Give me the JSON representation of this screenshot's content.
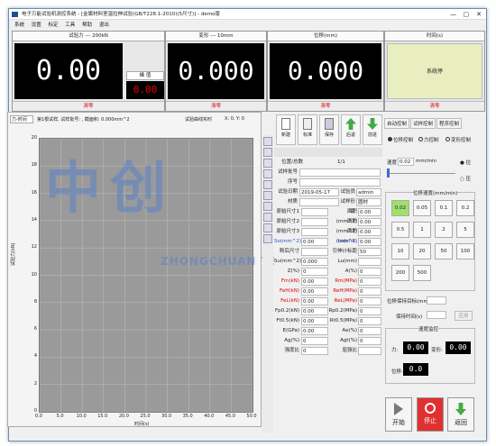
{
  "window": {
    "title": "电子万能试验机测控系统 - [金属材料室温拉伸试验(GB/T228.1-2010)(5尺寸)] - demo版",
    "controls": [
      "—",
      "▢",
      "✕"
    ]
  },
  "menu": [
    "系统",
    "设置",
    "标定",
    "工具",
    "帮助",
    "退出"
  ],
  "meters": {
    "force": {
      "caption": "试验力 --- 200kN",
      "value": "0.00",
      "peak_caption": "峰 值",
      "peak_value": "0.00",
      "zero": "清零"
    },
    "deform": {
      "caption": "变形 --- 10mm",
      "value": "0.000",
      "zero": "清零"
    },
    "disp": {
      "caption": "位移(mm)",
      "value": "0.000",
      "zero": "清零"
    },
    "time": {
      "caption": "时间(s)",
      "status": "系统停",
      "zero": "清零"
    }
  },
  "chart_header": {
    "mode": "力-时间",
    "info": "第1根试样, 试样批号: , 截面积: 0.000mm^2",
    "coord_label": "试验曲线实时",
    "coord": "X: 0, Y: 0"
  },
  "chart_data": {
    "type": "line",
    "xlabel": "时间(s)",
    "ylabel": "试验力(kN)",
    "xlim": [
      0,
      50
    ],
    "ylim": [
      0,
      20
    ],
    "x_ticks": [
      "0.0",
      "5.0",
      "10.0",
      "15.0",
      "20.0",
      "25.0",
      "30.0",
      "35.0",
      "40.0",
      "45.0",
      "50.0"
    ],
    "y_ticks": [
      "20",
      "18",
      "16",
      "14",
      "12",
      "10",
      "8",
      "6",
      "4",
      "2",
      "0"
    ],
    "series": []
  },
  "watermark": {
    "cn": "中创",
    "en": "ZHONGCHUAN TESTING MACHINE"
  },
  "toolbar_mid": [
    "新建",
    "标准",
    "保存",
    "后退",
    "前进"
  ],
  "position_label": "位置/总数",
  "position_value": "1/1",
  "specimen_no_label": "试样批号",
  "num_label": "序号",
  "date_label": "试验日期",
  "date_value": "2019-05-17",
  "tester_label": "试验员",
  "tester_value": "admin",
  "material_label": "材质",
  "shape_label": "试样形状",
  "shape_value": "圆材",
  "params": [
    {
      "l": "原始尺寸1",
      "v": "",
      "l2": "面积(mm^2)",
      "v2": "0.00"
    },
    {
      "l": "原始尺寸2",
      "v": "",
      "l2": "面积(mm^2)",
      "v2": "0.00"
    },
    {
      "l": "原始尺寸3",
      "v": "",
      "l2": "面积(mm^2)",
      "v2": "0.00"
    },
    {
      "l": "So(mm^2)",
      "v": "0.00",
      "l2": "Lo(mm)",
      "v2": "0.00",
      "blue": true
    },
    {
      "l": "断后尺寸",
      "v": "",
      "l2": "引伸计标距",
      "v2": "50"
    },
    {
      "l": "Su(mm^2)",
      "v": "0.000",
      "l2": "Lu(mm)",
      "v2": ""
    },
    {
      "l": "Z(%)",
      "v": "0",
      "l2": "A(%)",
      "v2": "0"
    },
    {
      "l": "Fm(kN)",
      "v": "0.00",
      "l2": "Rm(MPa)",
      "v2": "0",
      "red": true
    },
    {
      "l": "FeH(kN)",
      "v": "0.00",
      "l2": "ReH(MPa)",
      "v2": "0",
      "red": true
    },
    {
      "l": "FeL(kN)",
      "v": "0.00",
      "l2": "ReL(MPa)",
      "v2": "0",
      "red": true
    },
    {
      "l": "Fp0.2(kN)",
      "v": "0.00",
      "l2": "Rp0.2(MPa)",
      "v2": "0"
    },
    {
      "l": "Ft0.5(kN)",
      "v": "0.00",
      "l2": "Rt0.5(MPa)",
      "v2": "0"
    },
    {
      "l": "E(GPa)",
      "v": "0.00",
      "l2": "Ae(%)",
      "v2": "0"
    },
    {
      "l": "Ag(%)",
      "v": "0",
      "l2": "Agt(%)",
      "v2": "0"
    },
    {
      "l": "强度比",
      "v": "0",
      "l2": "屈强比",
      "v2": ""
    }
  ],
  "right_tabs": [
    "自动控制",
    "试样控制",
    "程序控制"
  ],
  "modes": [
    "位移控制",
    "力控制",
    "变形控制"
  ],
  "speed_label": "速度",
  "speed_value": "0.02",
  "speed_unit": "mm/min",
  "dir_up": "拉",
  "dir_down": "压",
  "speed_group": "位移速度(mm/min)",
  "speeds": [
    "0.02",
    "0.05",
    "0.1",
    "0.2",
    "0.5",
    "1",
    "2",
    "5",
    "10",
    "20",
    "50",
    "100",
    "200",
    "500"
  ],
  "target_label": "位移保持目标(mm)",
  "hold_label": "保持时间(s)",
  "apply": "应用",
  "monitor": {
    "title": "速度监控",
    "force_label": "力:",
    "force": "0.00",
    "deform_label": "变形:",
    "deform": "0.00",
    "disp_label": "位移:",
    "disp": "0.0"
  },
  "actions": {
    "start": "开始",
    "stop": "停止",
    "back": "返回"
  }
}
